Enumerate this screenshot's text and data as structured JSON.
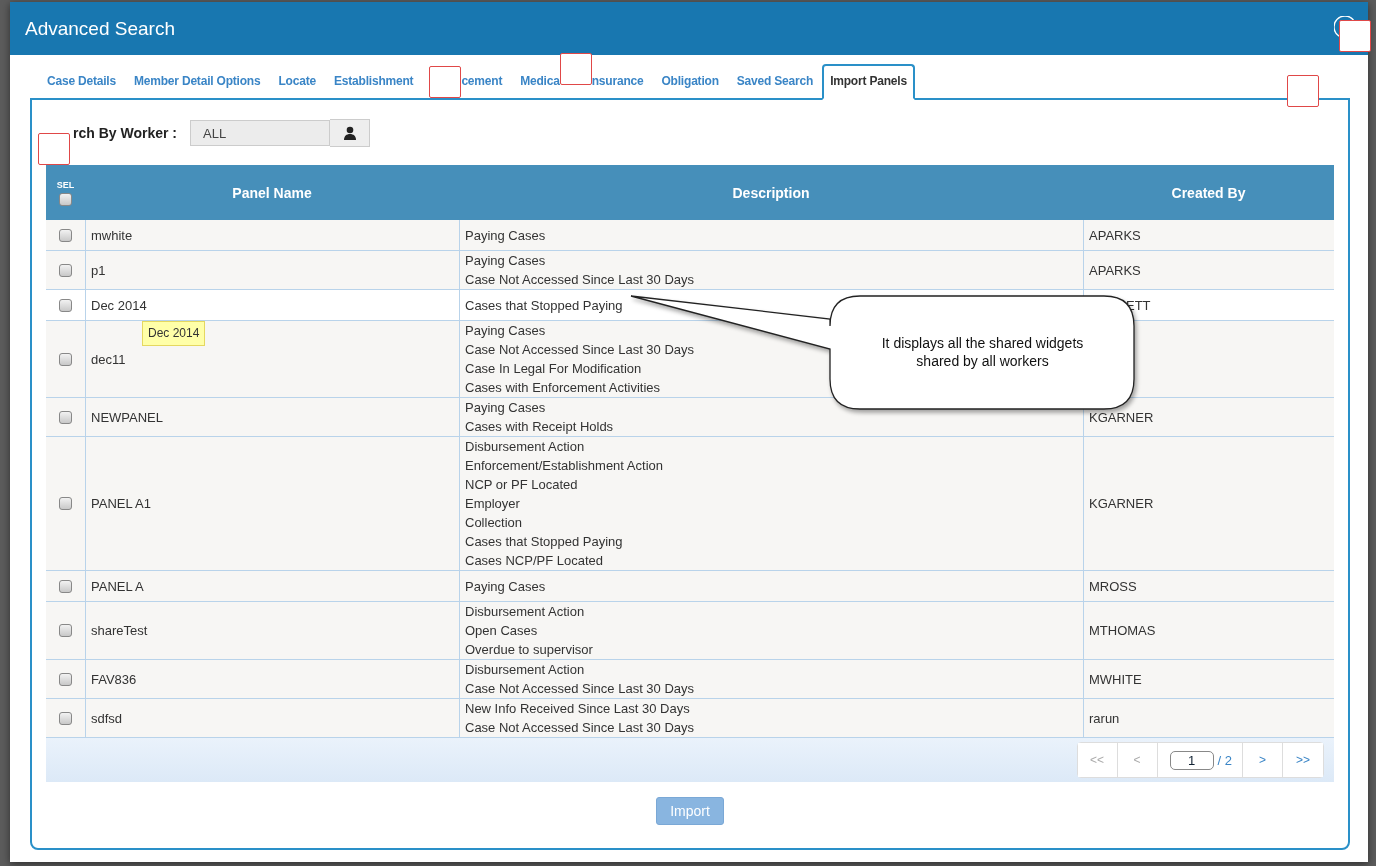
{
  "window": {
    "title": "Advanced Search"
  },
  "tabs": [
    {
      "label_parts": [
        "Case Details"
      ],
      "covered": false,
      "selected": false
    },
    {
      "label_parts": [
        "Member Detail Options"
      ],
      "covered": false,
      "selected": false
    },
    {
      "label_parts": [
        "Locate"
      ],
      "covered": false,
      "selected": false
    },
    {
      "label_parts": [
        "Establishment"
      ],
      "covered": false,
      "selected": false
    },
    {
      "label_parts": [
        "cement"
      ],
      "covered": true,
      "selected": false
    },
    {
      "label_parts": [
        "Medica",
        "nsurance"
      ],
      "covered": true,
      "selected": false
    },
    {
      "label_parts": [
        "Obligation"
      ],
      "covered": false,
      "selected": false
    },
    {
      "label_parts": [
        "Saved Search"
      ],
      "covered": false,
      "selected": false
    },
    {
      "label_parts": [
        "Import Panels"
      ],
      "covered": false,
      "selected": true
    }
  ],
  "search": {
    "label": "rch By Worker :",
    "value": "ALL"
  },
  "table": {
    "columns": [
      "SEL",
      "Panel Name",
      "Description",
      "Created By"
    ],
    "select_all_checked": false,
    "rows": [
      {
        "checked": false,
        "name": "mwhite",
        "description": [
          "Paying Cases"
        ],
        "created_by": "APARKS",
        "created_by_covered": false
      },
      {
        "checked": false,
        "name": "p1",
        "description": [
          "Paying Cases",
          "Case Not Accessed Since Last 30 Days"
        ],
        "created_by": "APARKS",
        "created_by_covered": false
      },
      {
        "checked": false,
        "name": "Dec 2014",
        "tooltip": "Dec 2014",
        "description": [
          "Cases that Stopped Paying"
        ],
        "created_by": "ETT",
        "created_by_covered": true
      },
      {
        "checked": false,
        "name": "dec11",
        "description": [
          "Paying Cases",
          "Case Not Accessed Since Last 30 Days",
          "Case In Legal For Modification",
          "Cases with Enforcement Activities"
        ]
      },
      {
        "checked": false,
        "name": "NEWPANEL",
        "description": [
          "Paying Cases",
          "Cases with Receipt Holds"
        ],
        "created_by": "KGARNER",
        "created_by_covered": false
      },
      {
        "checked": false,
        "name": "PANEL A1",
        "description": [
          "Disbursement Action",
          "Enforcement/Establishment Action",
          "NCP or PF Located",
          "Employer",
          "Collection",
          "Cases that Stopped Paying",
          "Cases NCP/PF Located"
        ],
        "created_by": "KGARNER",
        "created_by_covered": false
      },
      {
        "checked": false,
        "name": "PANEL A",
        "description": [
          "Paying Cases"
        ],
        "created_by": "MROSS",
        "created_by_covered": false
      },
      {
        "checked": false,
        "name": "shareTest",
        "description": [
          "Disbursement Action",
          "Open Cases",
          "Overdue to supervisor"
        ],
        "created_by": "MTHOMAS",
        "created_by_covered": false
      },
      {
        "checked": false,
        "name": "FAV836",
        "description": [
          "Disbursement Action",
          "Case Not Accessed Since Last 30 Days"
        ],
        "created_by": "MWHITE",
        "created_by_covered": false
      },
      {
        "checked": false,
        "name": "sdfsd",
        "description": [
          "New Info Received Since Last 30 Days",
          "Case Not Accessed Since Last 30 Days"
        ],
        "created_by": "rarun",
        "created_by_covered": false
      }
    ]
  },
  "pager": {
    "buttons": [
      {
        "label": "<<",
        "disabled": true
      },
      {
        "label": "<",
        "disabled": true
      },
      {
        "label": ">",
        "disabled": false
      },
      {
        "label": ">>",
        "disabled": false
      }
    ],
    "page": "1",
    "total": "/ 2"
  },
  "import_button": {
    "label": "Import",
    "disabled": true
  },
  "callout": {
    "lines": [
      "It displays all the shared widgets",
      "shared by all workers"
    ]
  }
}
